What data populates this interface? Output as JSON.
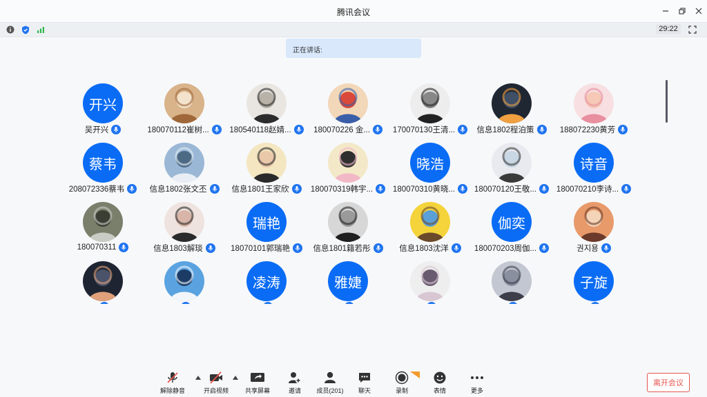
{
  "window": {
    "title": "腾讯会议"
  },
  "statusbar": {
    "timer": "29:22"
  },
  "speaking": {
    "label": "正在讲话:"
  },
  "participants": [
    {
      "name": "吴开兴",
      "avatar_text": "开兴"
    },
    {
      "name": "180070112崔树...",
      "avatar_image": "shiba-dog-photo"
    },
    {
      "name": "180540118赵婧...",
      "avatar_image": "cartoon-character-photo"
    },
    {
      "name": "180070226 金...",
      "avatar_image": "popeye-cartoon-photo"
    },
    {
      "name": "170070130王清...",
      "avatar_image": "black-white-portrait-photo"
    },
    {
      "name": "信息1802程泊策",
      "avatar_image": "sunset-sea-photo"
    },
    {
      "name": "188072230黄芳",
      "avatar_image": "girl-pink-hat-photo"
    },
    {
      "name": "208072336蔡韦",
      "avatar_text": "蔡韦"
    },
    {
      "name": "信息1802张文丕",
      "avatar_image": "railway-blue-photo"
    },
    {
      "name": "信息1801王家欣",
      "avatar_image": "anime-girl-photo"
    },
    {
      "name": "180070319韩宇...",
      "avatar_image": "cartoon-pig-photo"
    },
    {
      "name": "180070310黄晓...",
      "avatar_text": "晓浩"
    },
    {
      "name": "180070120王敬...",
      "avatar_image": "boy-portrait-photo"
    },
    {
      "name": "180070210李诗...",
      "avatar_text": "诗音"
    },
    {
      "name": "180070311",
      "avatar_image": "koala-photo"
    },
    {
      "name": "信息1803解琰",
      "avatar_image": "girl-selfie-photo"
    },
    {
      "name": "18070101郭瑞艳",
      "avatar_text": "瑞艳"
    },
    {
      "name": "信息1801籍若彤",
      "avatar_image": "dark-hair-photo"
    },
    {
      "name": "信息1803沈洋",
      "avatar_image": "spongebob-photo"
    },
    {
      "name": "180070203周伽...",
      "avatar_text": "伽奕"
    },
    {
      "name": "권지용",
      "avatar_image": "anime-girl-orange-photo"
    },
    {
      "name": "",
      "avatar_image": "silhouette-sunset-photo"
    },
    {
      "name": "",
      "avatar_image": "snowboard-photo"
    },
    {
      "name": "",
      "avatar_text": "凌涛"
    },
    {
      "name": "",
      "avatar_text": "雅婕"
    },
    {
      "name": "",
      "avatar_image": "anime-boy-photo"
    },
    {
      "name": "",
      "avatar_image": "boy-glasses-photo"
    },
    {
      "name": "",
      "avatar_text": "子旋"
    }
  ],
  "toolbar": {
    "unmute": "解除静音",
    "video": "开启视频",
    "share": "共享屏幕",
    "invite": "邀请",
    "members": "成员(201)",
    "chat": "聊天",
    "record": "录制",
    "reaction": "表情",
    "more": "更多",
    "leave": "离开会议"
  },
  "colors": {
    "accent_blue": "#0a6cf5",
    "mic_blue": "#1f74f0",
    "leave_red": "#e5554f",
    "speaking_bg": "#d9e8fb"
  }
}
